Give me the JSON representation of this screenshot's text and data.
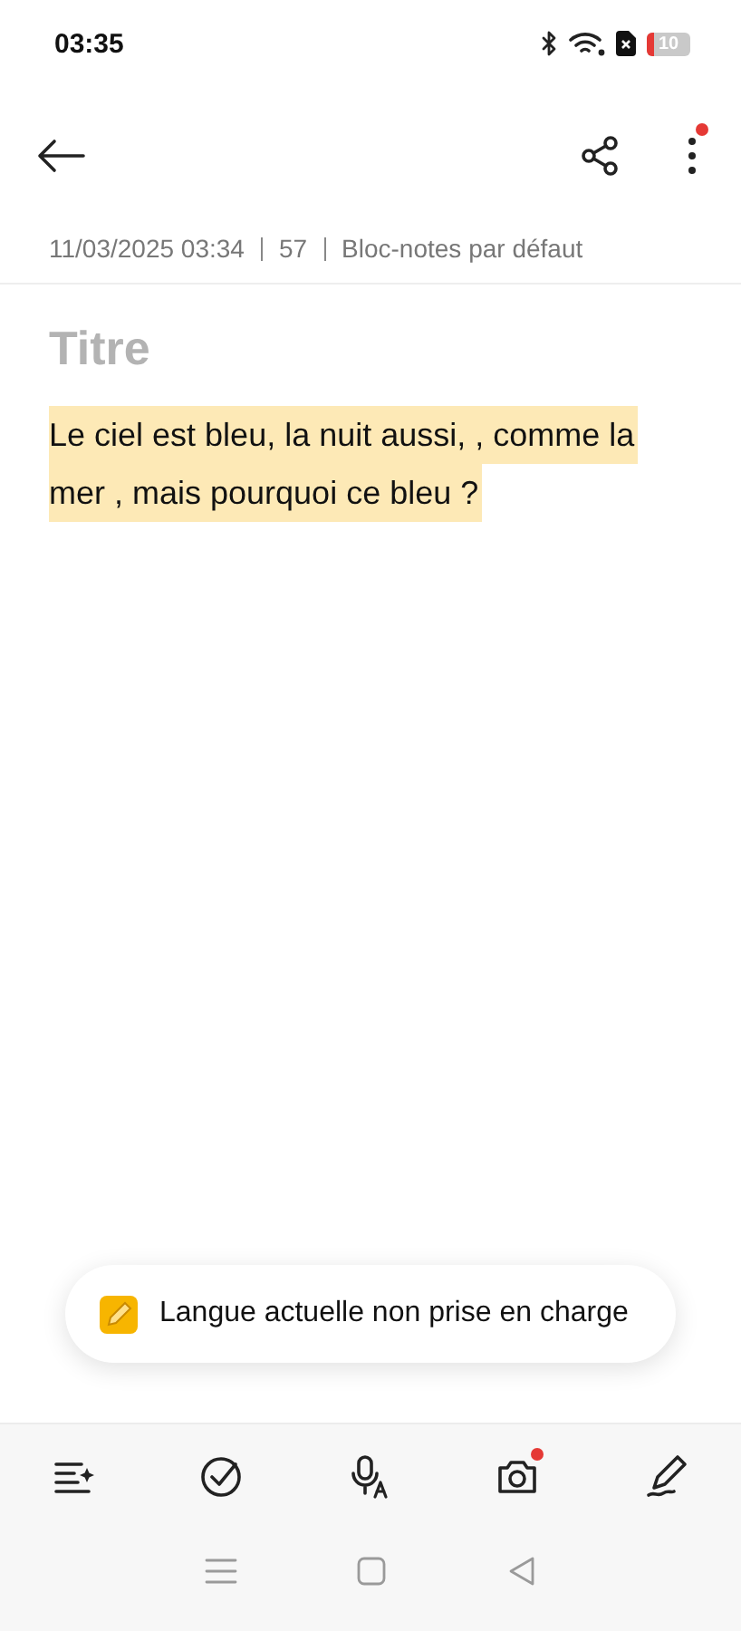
{
  "status_bar": {
    "time": "03:35",
    "battery": "10",
    "battery_low": true
  },
  "header": {
    "menu_badge": true
  },
  "meta": {
    "date": "11/03/2025 03:34",
    "count": "57",
    "notebook": "Bloc-notes par défaut"
  },
  "note": {
    "title_placeholder": "Titre",
    "body_lines": [
      {
        "text": "Le ciel est bleu, la nuit aussi, , comme la",
        "highlighted": true
      },
      {
        "text": "mer , mais pourquoi ce bleu ?",
        "highlighted": true
      }
    ]
  },
  "toast": {
    "text": "Langue actuelle non prise en charge"
  },
  "toolbar": [
    {
      "kind": "format",
      "badge": false
    },
    {
      "kind": "checklist",
      "badge": false
    },
    {
      "kind": "voice",
      "badge": false
    },
    {
      "kind": "camera",
      "badge": true
    },
    {
      "kind": "handwriting",
      "badge": false
    }
  ],
  "nav_bar": [
    {
      "kind": "menu"
    },
    {
      "kind": "home"
    },
    {
      "kind": "back"
    }
  ]
}
